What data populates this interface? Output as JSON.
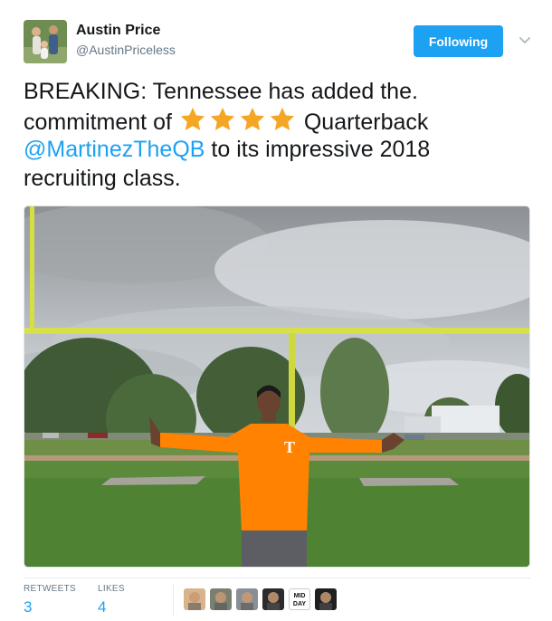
{
  "author": {
    "name": "Austin Price",
    "handle": "@AustinPriceless",
    "avatar_icon": "family-photo-avatar"
  },
  "follow_button": {
    "label": "Following"
  },
  "menu_icon": "chevron-down-icon",
  "tweet": {
    "line1": "BREAKING: Tennessee has added the.",
    "line2_before": "commitment of",
    "star_count": 4,
    "star_color": "#f5a623",
    "line2_after": "Quarterback",
    "mention": "@MartinezTheQB",
    "line3_after": "to its impressive 2018",
    "line4": "recruiting class."
  },
  "media": {
    "type": "photo",
    "shirt_logo": "T"
  },
  "stats": {
    "retweets_label": "RETWEETS",
    "retweets_value": "3",
    "likes_label": "LIKES",
    "likes_value": "4"
  },
  "likers": [
    {
      "name": "liker-avatar-1",
      "bg": "#d9b38c"
    },
    {
      "name": "liker-avatar-2",
      "bg": "#7a7f70"
    },
    {
      "name": "liker-avatar-3",
      "bg": "#8a8f95"
    },
    {
      "name": "liker-avatar-4",
      "bg": "#2b2b2b"
    },
    {
      "name": "liker-avatar-5",
      "bg": "#ffffff",
      "text": "MID DAY"
    },
    {
      "name": "liker-avatar-6",
      "bg": "#1f1f1f"
    }
  ],
  "colors": {
    "accent": "#1da1f2",
    "text": "#14171a",
    "muted": "#657786",
    "shirt_orange": "#ff8200"
  }
}
